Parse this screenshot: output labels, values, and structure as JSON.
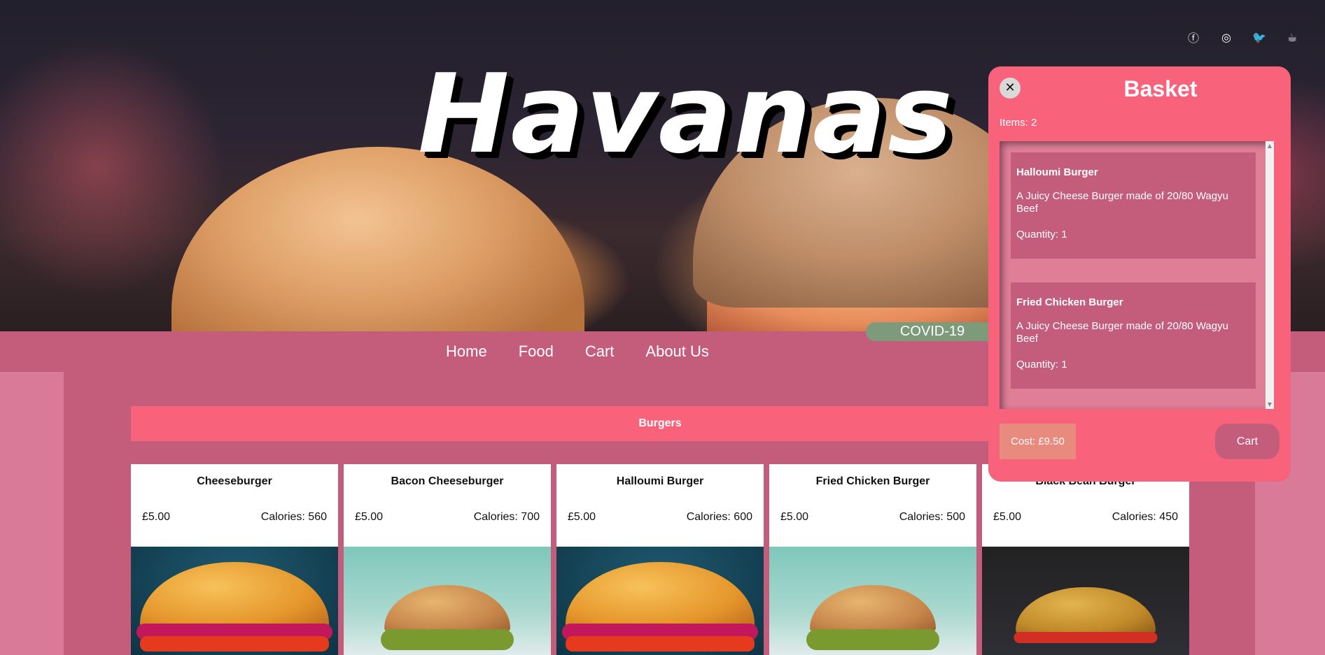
{
  "brand": {
    "title": "Havanas"
  },
  "social": {
    "facebook_glyph": "ⓕ",
    "instagram_glyph": "◎",
    "twitter_glyph": "🐦",
    "coffee_glyph": "☕",
    "icons": [
      "facebook-icon",
      "instagram-icon",
      "twitter-icon",
      "coffee-icon"
    ]
  },
  "nav": {
    "items": [
      {
        "label": "Home"
      },
      {
        "label": "Food"
      },
      {
        "label": "Cart"
      },
      {
        "label": "About Us"
      }
    ],
    "covid_label": "COVID-19"
  },
  "menu": {
    "category": "Burgers",
    "products": [
      {
        "name": "Cheeseburger",
        "price": "£5.00",
        "calories": "Calories: 560"
      },
      {
        "name": "Bacon Cheeseburger",
        "price": "£5.00",
        "calories": "Calories: 700"
      },
      {
        "name": "Halloumi Burger",
        "price": "£5.00",
        "calories": "Calories: 600"
      },
      {
        "name": "Fried Chicken Burger",
        "price": "£5.00",
        "calories": "Calories: 500"
      },
      {
        "name": "Black Bean Burger",
        "price": "£5.00",
        "calories": "Calories: 450"
      }
    ]
  },
  "basket": {
    "close_glyph": "✕",
    "title": "Basket",
    "items_count": "Items: 2",
    "items": [
      {
        "name": "Halloumi Burger",
        "description": "A Juicy Cheese Burger made of 20/80 Wagyu Beef",
        "quantity": "Quantity: 1"
      },
      {
        "name": "Fried Chicken Burger",
        "description": "A Juicy Cheese Burger made of 20/80 Wagyu Beef",
        "quantity": "Quantity: 1"
      }
    ],
    "cost": "Cost: £9.50",
    "cart_label": "Cart",
    "scroll_up_glyph": "▲",
    "scroll_down_glyph": "▼"
  },
  "colors": {
    "accent": "#f8637b",
    "nav": "#c45d7c",
    "page": "#d87a98",
    "covid": "#7d9b7a",
    "cost": "#e98a7e"
  }
}
